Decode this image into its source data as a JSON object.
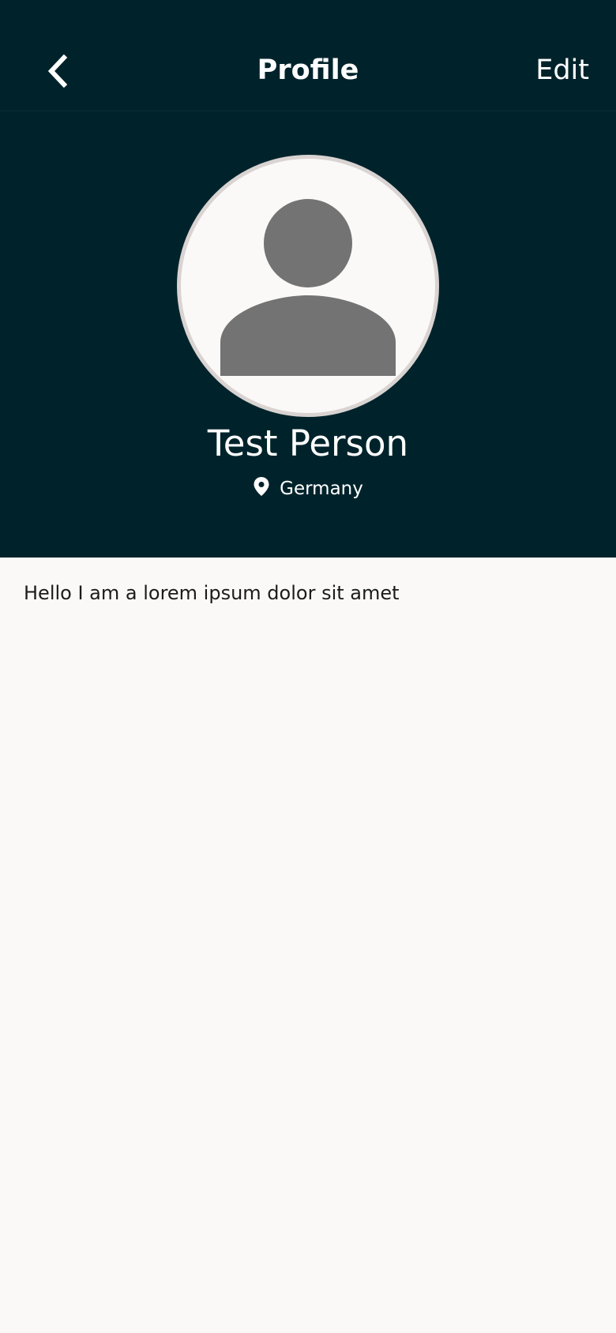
{
  "colors": {
    "header_background": "#00232B",
    "page_background": "#FAF9F7",
    "avatar_placeholder": "#737373",
    "avatar_border": "#D9D3D2",
    "header_text": "#FFFFFF",
    "body_text": "#1B1B1B"
  },
  "nav": {
    "back_icon": "chevron-left-icon",
    "title": "Profile",
    "edit_label": "Edit"
  },
  "profile": {
    "avatar_icon": "person-placeholder-icon",
    "name": "Test Person",
    "location_icon": "location-pin-icon",
    "location": "Germany",
    "bio": "Hello I am a lorem ipsum dolor sit amet"
  }
}
